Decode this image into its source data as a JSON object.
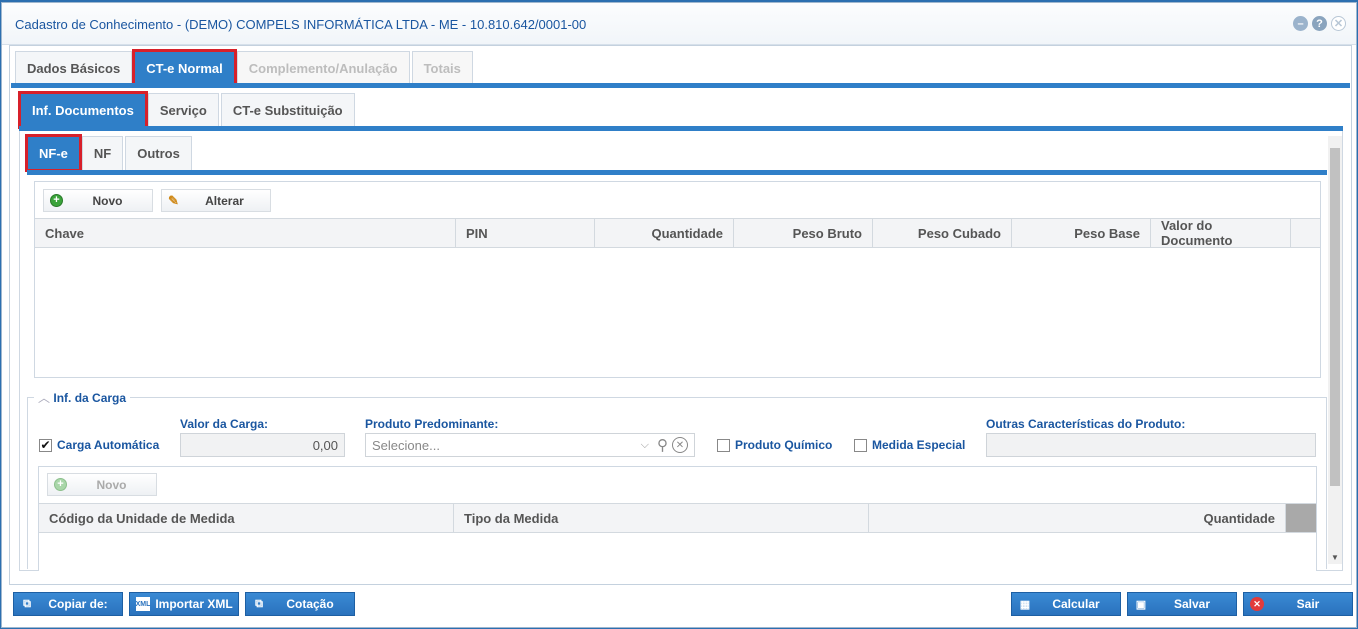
{
  "window": {
    "title": "Cadastro de Conhecimento - (DEMO) COMPELS INFORMÁTICA LTDA - ME - 10.810.642/0001-00"
  },
  "main_tabs": [
    {
      "label": "Dados Básicos"
    },
    {
      "label": "CT-e Normal"
    },
    {
      "label": "Complemento/Anulação"
    },
    {
      "label": "Totais"
    }
  ],
  "sub_tabs": [
    {
      "label": "Inf. Documentos"
    },
    {
      "label": "Serviço"
    },
    {
      "label": "CT-e Substituição"
    }
  ],
  "doc_tabs": [
    {
      "label": "NF-e"
    },
    {
      "label": "NF"
    },
    {
      "label": "Outros"
    }
  ],
  "nfe_toolbar": {
    "new_label": "Novo",
    "edit_label": "Alterar"
  },
  "nfe_grid": {
    "columns": [
      "Chave",
      "PIN",
      "Quantidade",
      "Peso Bruto",
      "Peso Cubado",
      "Peso Base",
      "Valor do Documento"
    ],
    "rows": []
  },
  "carga": {
    "legend": "Inf. da Carga",
    "auto_label": "Carga Automática",
    "auto_checked": true,
    "valor_label": "Valor da Carga:",
    "valor_value": "0,00",
    "produto_label": "Produto Predominante:",
    "produto_placeholder": "Selecione...",
    "quimico_label": "Produto Químico",
    "medida_label": "Medida Especial",
    "outras_label": "Outras Características do Produto:",
    "outras_value": "",
    "new_label": "Novo",
    "grid_columns": [
      "Código da Unidade de Medida",
      "Tipo da Medida",
      "Quantidade"
    ]
  },
  "footer": {
    "copy_label": "Copiar de:",
    "import_label": "Importar XML",
    "quote_label": "Cotação",
    "calc_label": "Calcular",
    "save_label": "Salvar",
    "exit_label": "Sair"
  },
  "colors": {
    "accent": "#2f7fc8",
    "highlight": "#d7202a",
    "title": "#1a56a0"
  }
}
